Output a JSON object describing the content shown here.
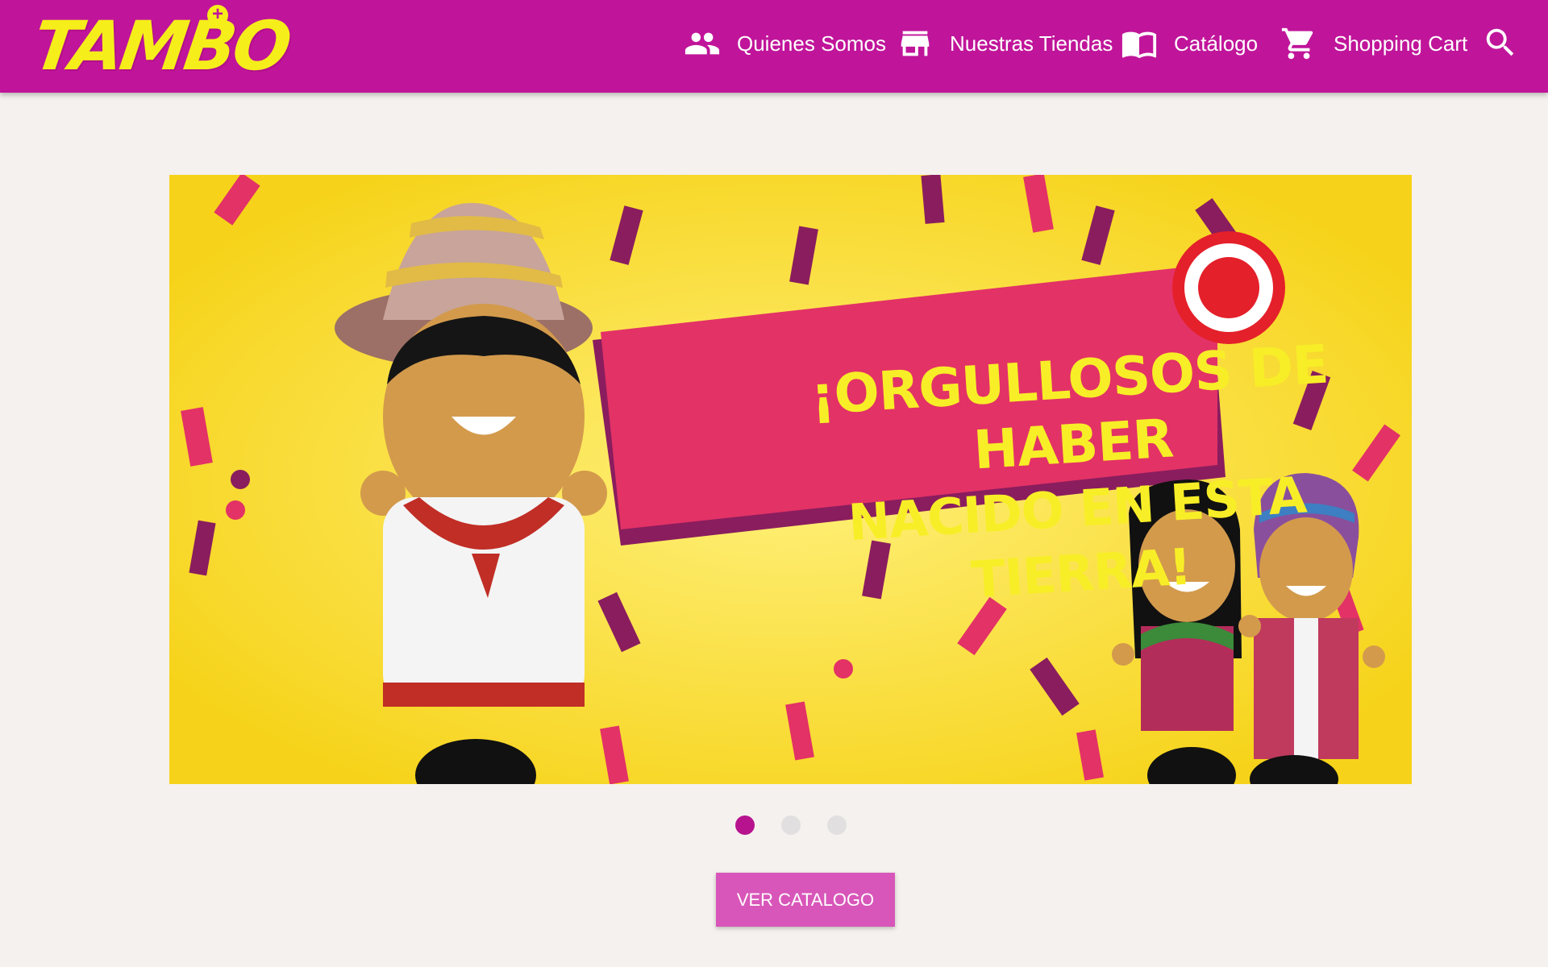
{
  "brand": {
    "logo_text": "TAMBO",
    "logo_plus": "+"
  },
  "colors": {
    "nav_bg": "#c0159a",
    "accent_yellow": "#f6ee1a",
    "banner_bg": "#f7d51d",
    "banner_pink": "#e33266",
    "banner_purple": "#8a1d5e",
    "button_bg": "#d856b9",
    "page_bg": "#f5f1ee"
  },
  "nav": {
    "items": [
      {
        "label": "Quienes Somos",
        "icon": "people-icon"
      },
      {
        "label": "Nuestras Tiendas",
        "icon": "store-icon"
      },
      {
        "label": "Catálogo",
        "icon": "book-icon"
      },
      {
        "label": "Shopping Cart",
        "icon": "cart-icon"
      }
    ],
    "search_icon": "search-icon"
  },
  "banner": {
    "headline_line1": "¡ORGULLOSOS DE HABER",
    "headline_line2": "NACIDO EN ESTA TIERRA!"
  },
  "carousel": {
    "slide_count": 3,
    "active_index": 0
  },
  "cta": {
    "label": "VER CATALOGO"
  }
}
